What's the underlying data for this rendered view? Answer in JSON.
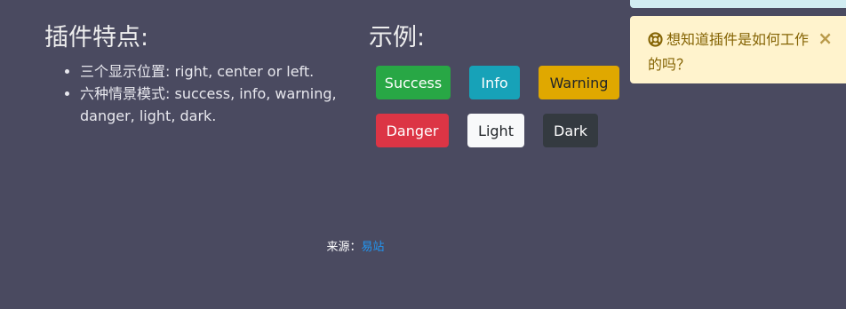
{
  "features": {
    "title": "插件特点:",
    "items": [
      "三个显示位置: right, center or left.",
      "六种情景模式: success, info, warning, danger, light, dark."
    ]
  },
  "examples": {
    "title": "示例:",
    "buttons": {
      "success": "Success",
      "info": "Info",
      "warning": "Warning",
      "danger": "Danger",
      "light": "Light",
      "dark": "Dark"
    }
  },
  "toast": {
    "icon": "lifebuoy-icon",
    "message": "想知道插件是如何工作的吗？",
    "close_label": "×"
  },
  "footer": {
    "source_label": "来源：",
    "source_link": "易站"
  },
  "colors": {
    "background": "#4a4a60",
    "success": "#28a745",
    "info": "#17a2b8",
    "warning": "#e0a800",
    "danger": "#dc3545",
    "light": "#f8f9fa",
    "dark": "#343a40",
    "toast_bg": "#fff3cd",
    "toast_text": "#856404",
    "link": "#2196f3"
  }
}
